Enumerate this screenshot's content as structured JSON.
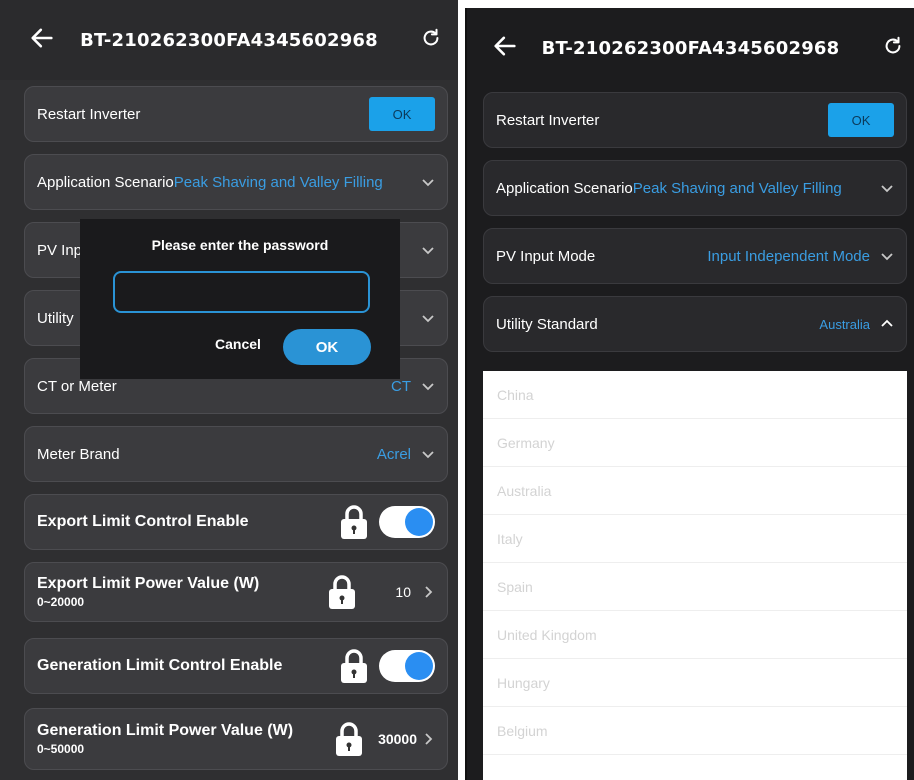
{
  "device_id": "BT-210262300FA4345602968",
  "left": {
    "restart": {
      "label": "Restart Inverter",
      "button": "OK"
    },
    "application": {
      "label": "Application Scenario",
      "value": "Peak Shaving and Valley Filling"
    },
    "pv_input": {
      "label": "PV Inp"
    },
    "utility": {
      "label": "Utility"
    },
    "ct_meter": {
      "label": "CT or Meter",
      "value": "CT"
    },
    "meter_brand": {
      "label": "Meter Brand",
      "value": "Acrel"
    },
    "export_enable": {
      "label": "Export Limit Control Enable",
      "on": true
    },
    "export_power": {
      "label": "Export Limit Power Value (W)",
      "range": "0~20000",
      "value": "10"
    },
    "gen_enable": {
      "label": "Generation Limit Control Enable",
      "on": true
    },
    "gen_power": {
      "label": "Generation Limit Power Value (W)",
      "range": "0~50000",
      "value": "30000"
    },
    "dialog": {
      "title": "Please enter the password",
      "input_value": "",
      "cancel": "Cancel",
      "ok": "OK"
    }
  },
  "right": {
    "restart": {
      "label": "Restart Inverter",
      "button": "OK"
    },
    "application": {
      "label": "Application Scenario",
      "value": "Peak Shaving and Valley Filling"
    },
    "pv_input": {
      "label": "PV Input Mode",
      "value": "Input Independent Mode"
    },
    "utility": {
      "label": "Utility Standard",
      "value": "Australia"
    },
    "options": [
      "China",
      "Germany",
      "Australia",
      "Italy",
      "Spain",
      "United Kingdom",
      "Hungary",
      "Belgium"
    ]
  },
  "colors": {
    "accent": "#1ba1e9",
    "value_text": "#3a9de2",
    "toggle_on": "#2a8ef2"
  },
  "icons": [
    "back-arrow-icon",
    "refresh-icon",
    "chevron-down-icon",
    "chevron-up-icon",
    "chevron-right-icon",
    "lock-icon"
  ]
}
